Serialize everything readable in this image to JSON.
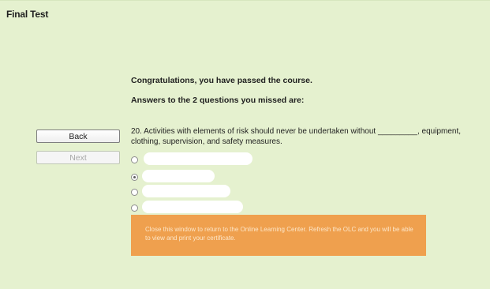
{
  "window": {
    "title": "Final Test"
  },
  "result": {
    "congrats": "Congratulations, you have passed the course.",
    "missed_heading": "Answers to the 2 questions you missed are:"
  },
  "question": {
    "text": "20. Activities with elements of risk should never be undertaken without _________, equipment, clothing, supervision, and safety measures.",
    "options": [
      {
        "selected": false,
        "content": "redacted"
      },
      {
        "selected": true,
        "content": "redacted"
      },
      {
        "selected": false,
        "content": "redacted"
      },
      {
        "selected": false,
        "content": "redacted"
      }
    ]
  },
  "navigation": {
    "back_label": "Back",
    "next_label": "Next",
    "next_enabled": false
  },
  "notice": {
    "text": "Close this window to return to the Online Learning Center. Refresh the OLC and you will be able to view and print your certificate."
  },
  "colors": {
    "background": "#e5f1cf",
    "notice_background": "#efa04e",
    "notice_text": "#fde6c8"
  }
}
